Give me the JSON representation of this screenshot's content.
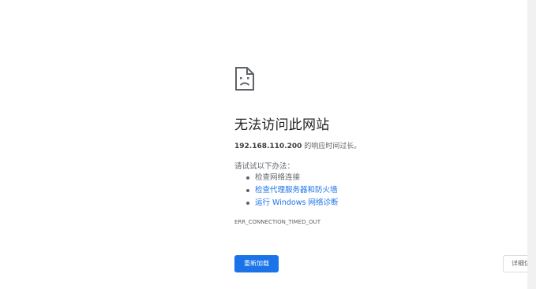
{
  "error_page": {
    "icon": "sad-page-icon",
    "title": "无法访问此网站",
    "summary_host": "192.168.110.200",
    "summary_text": " 的响应时间过长。",
    "suggestions_heading": "请试试以下办法：",
    "suggestions": [
      {
        "label": "检查网络连接",
        "link": false
      },
      {
        "label": "检查代理服务器和防火墙",
        "link": true
      },
      {
        "label": "运行 Windows 网络诊断",
        "link": true
      }
    ],
    "error_code": "ERR_CONNECTION_TIMED_OUT",
    "reload_label": "重新加载",
    "details_label": "详细信息"
  },
  "colors": {
    "accent": "#1a73e8",
    "text_primary": "#202124",
    "text_secondary": "#5f6368"
  }
}
